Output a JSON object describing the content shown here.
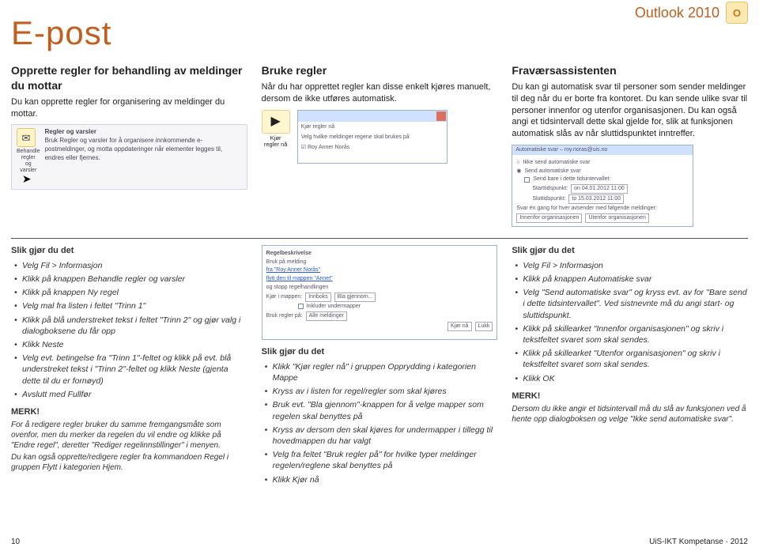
{
  "header": {
    "section": "E-post",
    "app": "Outlook 2010",
    "badge": "O"
  },
  "col1": {
    "title": "Opprette regler for behandling av meldinger du mottar",
    "body": "Du kan opprette regler for organisering av meldinger du mottar.",
    "fig_icon_label1": "Behandle regler",
    "fig_icon_label2": "og varsler",
    "fig_heading": "Regler og varsler",
    "fig_desc": "Bruk Regler og varsler for å organisere innkommende e-postmeldinger, og motta oppdateringer når elementer legges til, endres eller fjernes."
  },
  "col2": {
    "title": "Bruke regler",
    "body": "Når du har opprettet regler kan disse enkelt kjøres manuelt, dersom de ikke utføres automatisk.",
    "kjorbtn1": "Kjør",
    "kjorbtn2": "regler nå",
    "dlg_title": "Kjør regler nå",
    "dlg_row1": "Velg hvilke meldinger regene skal brukes på",
    "dlg_row2": "☑ Roy Anner Norås"
  },
  "col3": {
    "title": "Fraværsassistenten",
    "body": "Du kan gi automatisk svar til personer som sender meldinger til deg når du er borte fra kontoret. Du kan sende ulike svar til personer innenfor og utenfor organisasjonen. Du kan også angi et tidsintervall dette skal gjelde for, slik at funksjonen automatisk slås av når sluttidspunktet inntreffer.",
    "dlg_title": "Automatiske svar – roy.noras@uis.no",
    "o_send": "Send automatiske svar",
    "o_nosend": "Ikke send automatiske svar",
    "o_interval": "Send bare i dette tidsintervallet:",
    "start_lbl": "Starttidspunkt:",
    "start_v": "on 04.01.2012   11:00",
    "end_lbl": "Sluttidspunkt:",
    "end_v": "to 15.03.2012   11:00",
    "note": "Svar én gang for hver avsender med følgende meldinger:",
    "tab1": "Innenfor organisasjonen",
    "tab2": "Utenfor organisasjonen"
  },
  "lcol1": {
    "slik": "Slik gjør du det",
    "items": [
      "Velg Fil > Informasjon",
      "Klikk på knappen Behandle regler og varsler",
      "Klikk på knappen Ny regel",
      "Velg mal fra listen i feltet \"Trinn 1\"",
      "Klikk på blå understreket tekst i feltet \"Trinn 2\" og gjør valg i dialogboksene du får opp",
      "Klikk Neste",
      "Velg evt. betingelse fra \"Trinn 1\"-feltet og klikk på evt. blå understreket tekst i \"Trinn 2\"-feltet og klikk Neste (gjenta dette til du er fornøyd)",
      "Avslutt med Fullfør"
    ],
    "merk": "MERK!",
    "merkp1": "For å redigere regler bruker du samme fremgangsmåte som ovenfor, men du merker da regelen du vil endre og klikke på \"Endre regel\", deretter \"Rediger regelinnstillinger\" i menyen.",
    "merkp2": "Du kan også opprette/redigere regler fra kommandoen Regel i gruppen Flytt i kategorien Hjem."
  },
  "lcol2": {
    "dlg_rows": [
      "Regelbeskrivelse",
      "Bruk på melding",
      "fra \"Roy Anner Norås\"",
      "flytt den til mappen \"Annet\"",
      "og stopp regelhandlingen"
    ],
    "dlg_kjor": "Kjør i mappen:",
    "dlg_inbox": "Innboks",
    "dlg_bla": "Bla gjennom...",
    "dlg_ink": "Inkluder undermapper",
    "dlg_bruk": "Bruk regler på:",
    "dlg_alle": "Alle meldinger",
    "dlg_b1": "Kjør nå",
    "dlg_b2": "Lukk",
    "slik": "Slik gjør du det",
    "items": [
      "Klikk \"Kjør regler nå\" i gruppen Opprydding i kategorien Mappe",
      "Kryss av i listen for regel/regler som skal kjøres",
      "Bruk evt. \"Bla gjennom\"-knappen for å velge mapper som regelen skal benyttes på",
      "Kryss av dersom den skal kjøres for undermapper i tillegg til hovedmappen du har valgt",
      "Velg fra feltet \"Bruk regler på\" for hvilke typer meldinger regelen/reglene skal benyttes på",
      "Klikk Kjør nå"
    ]
  },
  "lcol3": {
    "slik": "Slik gjør du det",
    "items": [
      "Velg Fil > Informasjon",
      "Klikk på knappen Automatiske svar",
      "Velg \"Send automatiske svar\" og kryss evt. av for \"Bare send i dette tidsintervallet\". Ved sistnevnte må du angi start- og sluttidspunkt.",
      "Klikk på skillearket \"Innenfor organisasjonen\" og skriv i tekstfeltet svaret som skal sendes.",
      "Klikk på skillearket \"Utenfor organisasjonen\" og skriv i tekstfeltet svaret som skal sendes.",
      "Klikk OK"
    ],
    "merk": "MERK!",
    "merkp": "Dersom du ikke angir et tidsintervall må du slå av funksjonen ved å hente opp dialogboksen og velge \"Ikke send automatiske svar\"."
  },
  "footer": {
    "page": "10",
    "cred": "UiS-IKT Kompetanse · 2012"
  }
}
